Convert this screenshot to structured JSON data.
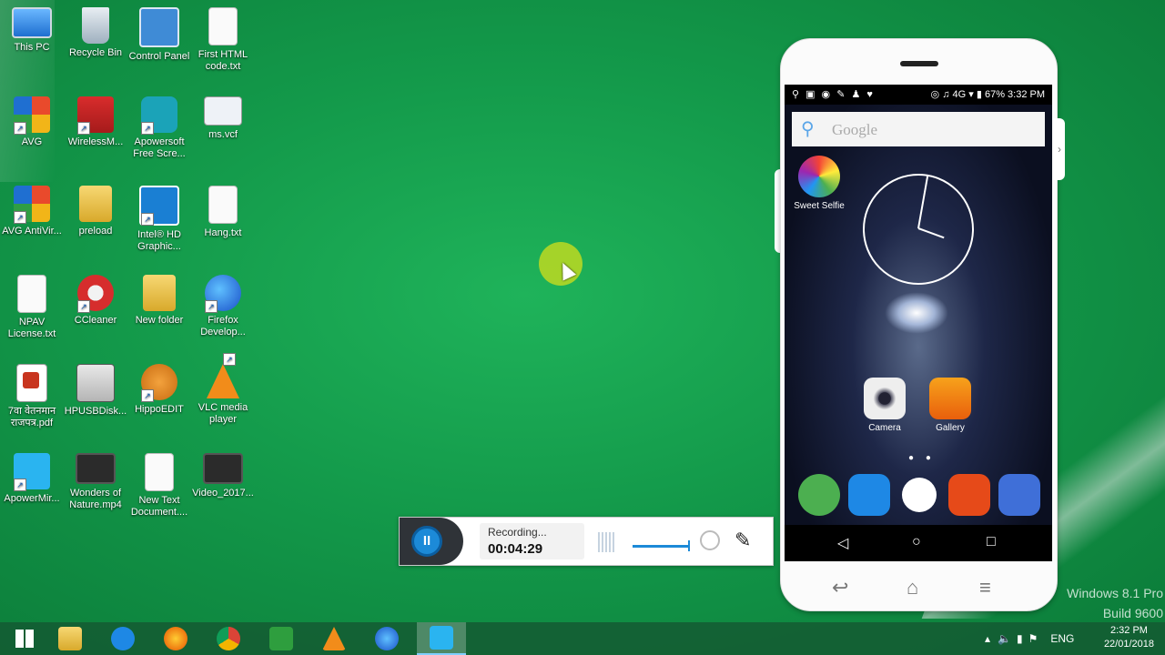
{
  "desktop": {
    "icons": [
      {
        "label": "This PC",
        "icon": "this-pc-icon"
      },
      {
        "label": "Recycle Bin",
        "icon": "recycle-bin-icon"
      },
      {
        "label": "Control Panel",
        "icon": "control-panel-icon"
      },
      {
        "label": "First HTML code.txt",
        "icon": "text-file-icon"
      },
      {
        "label": "AVG",
        "icon": "avg-icon"
      },
      {
        "label": "WirelessM...",
        "icon": "wireless-manager-icon"
      },
      {
        "label": "Apowersoft Free Scre...",
        "icon": "apowersoft-recorder-icon"
      },
      {
        "label": "ms.vcf",
        "icon": "vcard-icon"
      },
      {
        "label": "AVG AntiVir...",
        "icon": "avg-antivirus-icon"
      },
      {
        "label": "preload",
        "icon": "folder-icon"
      },
      {
        "label": "Intel® HD Graphic...",
        "icon": "intel-graphics-icon"
      },
      {
        "label": "Hang.txt",
        "icon": "text-file-icon"
      },
      {
        "label": "NPAV License.txt",
        "icon": "text-file-icon"
      },
      {
        "label": "CCleaner",
        "icon": "ccleaner-icon"
      },
      {
        "label": "New folder",
        "icon": "folder-icon"
      },
      {
        "label": "Firefox Develop...",
        "icon": "firefox-dev-icon"
      },
      {
        "label": "7वा वेतनमान राजपत्र.pdf",
        "icon": "pdf-icon"
      },
      {
        "label": "HPUSBDisk...",
        "icon": "hp-usb-disk-icon"
      },
      {
        "label": "HippoEDIT",
        "icon": "hippoedit-icon"
      },
      {
        "label": "VLC media player",
        "icon": "vlc-icon"
      },
      {
        "label": "ApowerMir...",
        "icon": "apowermirror-icon"
      },
      {
        "label": "Wonders of Nature.mp4",
        "icon": "video-file-icon"
      },
      {
        "label": "New Text Document....",
        "icon": "text-file-icon"
      },
      {
        "label": "Video_2017...",
        "icon": "video-file-icon"
      }
    ]
  },
  "recorder": {
    "status": "Recording...",
    "time": "00:04:29",
    "pause_icon": "pause-icon"
  },
  "phone": {
    "status_right": "67%  3:32 PM",
    "network": "4G",
    "search_placeholder": "Google",
    "apps": {
      "sweet_selfie": "Sweet Selfie",
      "camera": "Camera",
      "gallery": "Gallery"
    },
    "colors": {
      "phone_app": "#4caf50",
      "contacts_app": "#1e88e5",
      "messages_app": "#e64a19",
      "settings_app": "#3f6fd8"
    }
  },
  "watermark": {
    "line1": "Windows 8.1 Pro",
    "line2": "Build 9600"
  },
  "taskbar": {
    "lang": "ENG",
    "time": "2:32 PM",
    "date": "22/01/2018"
  }
}
